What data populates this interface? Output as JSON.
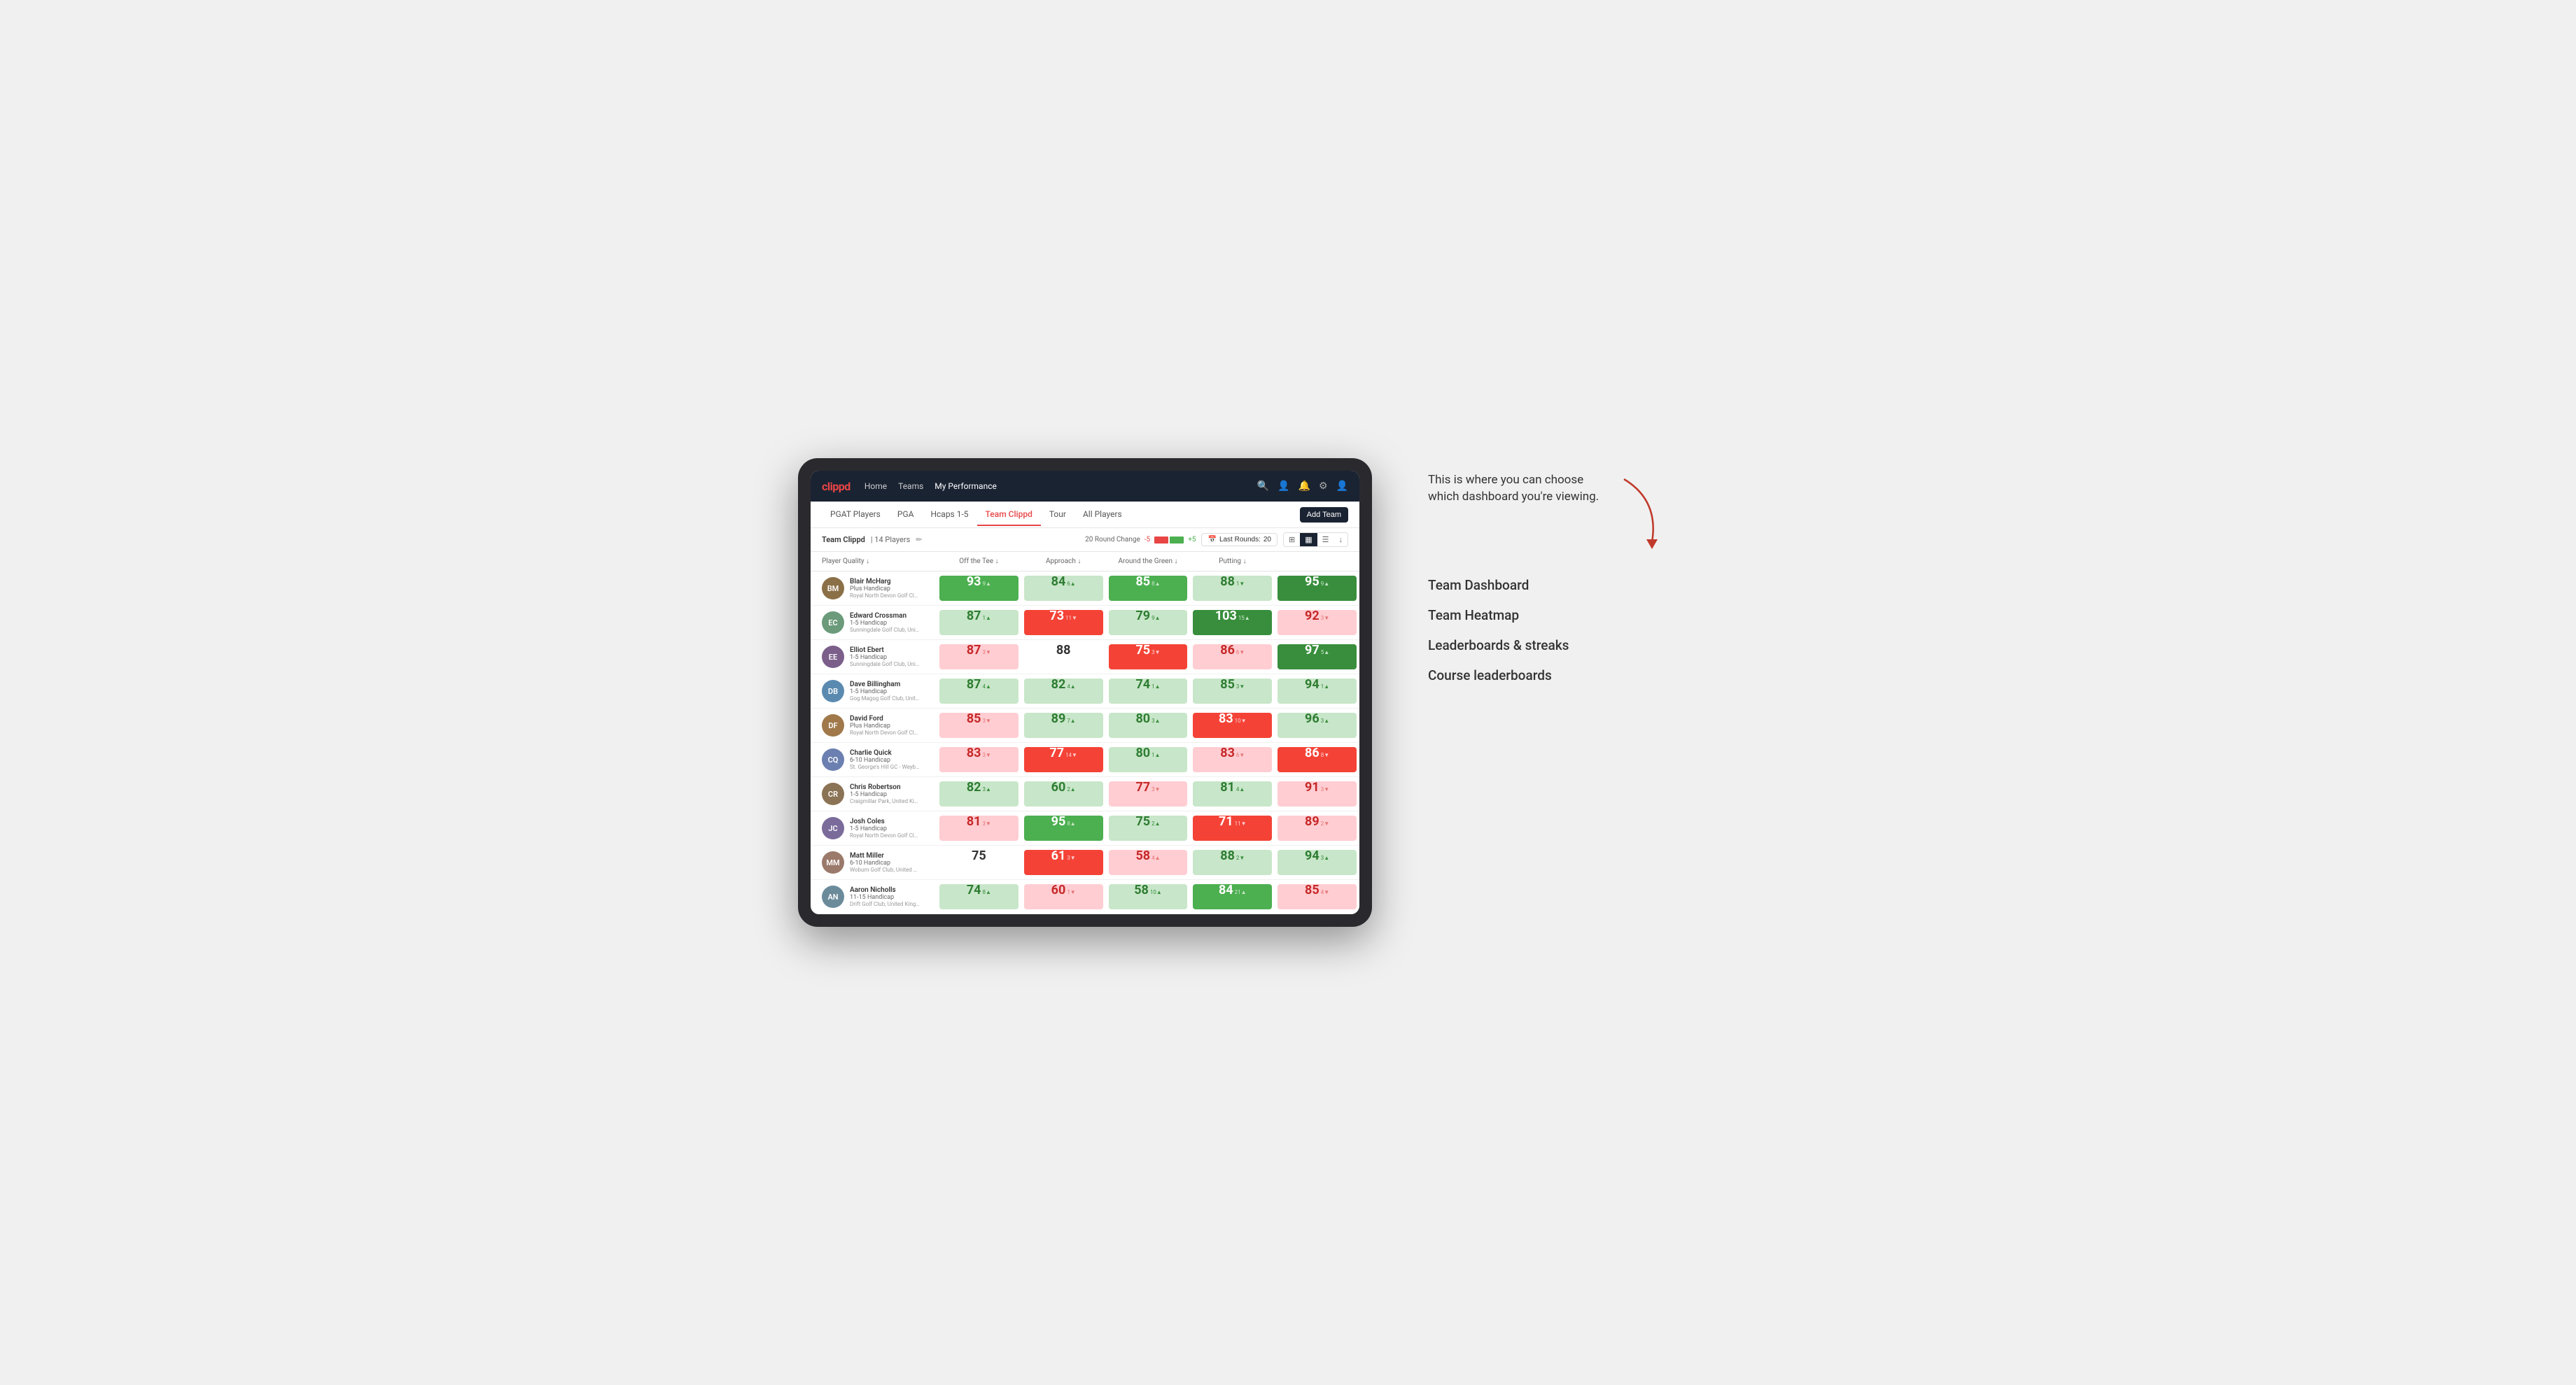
{
  "annotation": {
    "callout_text": "This is where you can choose which dashboard you're viewing.",
    "options": [
      "Team Dashboard",
      "Team Heatmap",
      "Leaderboards & streaks",
      "Course leaderboards"
    ]
  },
  "nav": {
    "logo": "clippd",
    "links": [
      "Home",
      "Teams",
      "My Performance"
    ],
    "active_link": "My Performance"
  },
  "sub_nav": {
    "links": [
      "PGAT Players",
      "PGA",
      "Hcaps 1-5",
      "Team Clippd",
      "Tour",
      "All Players"
    ],
    "active_link": "Team Clippd",
    "add_team_label": "Add Team"
  },
  "team_header": {
    "name": "Team Clippd",
    "separator": "|",
    "count": "14 Players",
    "round_change_label": "20 Round Change",
    "change_minus": "-5",
    "change_plus": "+5",
    "last_rounds_label": "Last Rounds:",
    "last_rounds_value": "20"
  },
  "table": {
    "columns": [
      "Player Quality ↓",
      "Off the Tee ↓",
      "Approach ↓",
      "Around the Green ↓",
      "Putting ↓"
    ],
    "rows": [
      {
        "name": "Blair McHarg",
        "hcp": "Plus Handicap",
        "club": "Royal North Devon Golf Club, United Kingdom",
        "initials": "BM",
        "avatar_color": "#8B6F47",
        "scores": [
          {
            "value": "93",
            "change": "9▲",
            "style": "green"
          },
          {
            "value": "84",
            "change": "6▲",
            "style": "light-green"
          },
          {
            "value": "85",
            "change": "8▲",
            "style": "green"
          },
          {
            "value": "88",
            "change": "1▼",
            "style": "light-green"
          },
          {
            "value": "95",
            "change": "9▲",
            "style": "dark-green"
          }
        ]
      },
      {
        "name": "Edward Crossman",
        "hcp": "1-5 Handicap",
        "club": "Sunningdale Golf Club, United Kingdom",
        "initials": "EC",
        "avatar_color": "#6B9B7A",
        "scores": [
          {
            "value": "87",
            "change": "1▲",
            "style": "light-green"
          },
          {
            "value": "73",
            "change": "11▼",
            "style": "red"
          },
          {
            "value": "79",
            "change": "9▲",
            "style": "light-green"
          },
          {
            "value": "103",
            "change": "15▲",
            "style": "dark-green"
          },
          {
            "value": "92",
            "change": "3▼",
            "style": "light-red"
          }
        ]
      },
      {
        "name": "Elliot Ebert",
        "hcp": "1-5 Handicap",
        "club": "Sunningdale Golf Club, United Kingdom",
        "initials": "EE",
        "avatar_color": "#7B5E8A",
        "scores": [
          {
            "value": "87",
            "change": "3▼",
            "style": "light-red"
          },
          {
            "value": "88",
            "change": "",
            "style": "white"
          },
          {
            "value": "75",
            "change": "3▼",
            "style": "red"
          },
          {
            "value": "86",
            "change": "6▼",
            "style": "light-red"
          },
          {
            "value": "97",
            "change": "5▲",
            "style": "dark-green"
          }
        ]
      },
      {
        "name": "Dave Billingham",
        "hcp": "1-5 Handicap",
        "club": "Gog Magog Golf Club, United Kingdom",
        "initials": "DB",
        "avatar_color": "#5B8AB0",
        "scores": [
          {
            "value": "87",
            "change": "4▲",
            "style": "light-green"
          },
          {
            "value": "82",
            "change": "4▲",
            "style": "light-green"
          },
          {
            "value": "74",
            "change": "1▲",
            "style": "light-green"
          },
          {
            "value": "85",
            "change": "3▼",
            "style": "light-green"
          },
          {
            "value": "94",
            "change": "1▲",
            "style": "light-green"
          }
        ]
      },
      {
        "name": "David Ford",
        "hcp": "Plus Handicap",
        "club": "Royal North Devon Golf Club, United Kingdom",
        "initials": "DF",
        "avatar_color": "#A0784A",
        "scores": [
          {
            "value": "85",
            "change": "3▼",
            "style": "light-red"
          },
          {
            "value": "89",
            "change": "7▲",
            "style": "light-green"
          },
          {
            "value": "80",
            "change": "3▲",
            "style": "light-green"
          },
          {
            "value": "83",
            "change": "10▼",
            "style": "red"
          },
          {
            "value": "96",
            "change": "3▲",
            "style": "light-green"
          }
        ]
      },
      {
        "name": "Charlie Quick",
        "hcp": "6-10 Handicap",
        "club": "St. George's Hill GC - Weybridge, Surrey, Uni...",
        "initials": "CQ",
        "avatar_color": "#6B7FB0",
        "scores": [
          {
            "value": "83",
            "change": "3▼",
            "style": "light-red"
          },
          {
            "value": "77",
            "change": "14▼",
            "style": "red"
          },
          {
            "value": "80",
            "change": "1▲",
            "style": "light-green"
          },
          {
            "value": "83",
            "change": "6▼",
            "style": "light-red"
          },
          {
            "value": "86",
            "change": "8▼",
            "style": "red"
          }
        ]
      },
      {
        "name": "Chris Robertson",
        "hcp": "1-5 Handicap",
        "club": "Craigmillar Park, United Kingdom",
        "initials": "CR",
        "avatar_color": "#8B7355",
        "scores": [
          {
            "value": "82",
            "change": "3▲",
            "style": "light-green"
          },
          {
            "value": "60",
            "change": "2▲",
            "style": "light-green"
          },
          {
            "value": "77",
            "change": "3▼",
            "style": "light-red"
          },
          {
            "value": "81",
            "change": "4▲",
            "style": "light-green"
          },
          {
            "value": "91",
            "change": "3▼",
            "style": "light-red"
          }
        ]
      },
      {
        "name": "Josh Coles",
        "hcp": "1-5 Handicap",
        "club": "Royal North Devon Golf Club, United Kingdom",
        "initials": "JC",
        "avatar_color": "#7A6B9B",
        "scores": [
          {
            "value": "81",
            "change": "3▼",
            "style": "light-red"
          },
          {
            "value": "95",
            "change": "8▲",
            "style": "green"
          },
          {
            "value": "75",
            "change": "2▲",
            "style": "light-green"
          },
          {
            "value": "71",
            "change": "11▼",
            "style": "red"
          },
          {
            "value": "89",
            "change": "2▼",
            "style": "light-red"
          }
        ]
      },
      {
        "name": "Matt Miller",
        "hcp": "6-10 Handicap",
        "club": "Woburn Golf Club, United Kingdom",
        "initials": "MM",
        "avatar_color": "#9B7A6B",
        "scores": [
          {
            "value": "75",
            "change": "",
            "style": "white"
          },
          {
            "value": "61",
            "change": "3▼",
            "style": "red"
          },
          {
            "value": "58",
            "change": "4▲",
            "style": "light-red"
          },
          {
            "value": "88",
            "change": "2▼",
            "style": "light-green"
          },
          {
            "value": "94",
            "change": "3▲",
            "style": "light-green"
          }
        ]
      },
      {
        "name": "Aaron Nicholls",
        "hcp": "11-15 Handicap",
        "club": "Drift Golf Club, United Kingdom",
        "initials": "AN",
        "avatar_color": "#6B8B9B",
        "scores": [
          {
            "value": "74",
            "change": "8▲",
            "style": "light-green"
          },
          {
            "value": "60",
            "change": "1▼",
            "style": "light-red"
          },
          {
            "value": "58",
            "change": "10▲",
            "style": "light-green"
          },
          {
            "value": "84",
            "change": "21▲",
            "style": "green"
          },
          {
            "value": "85",
            "change": "4▼",
            "style": "light-red"
          }
        ]
      }
    ]
  }
}
